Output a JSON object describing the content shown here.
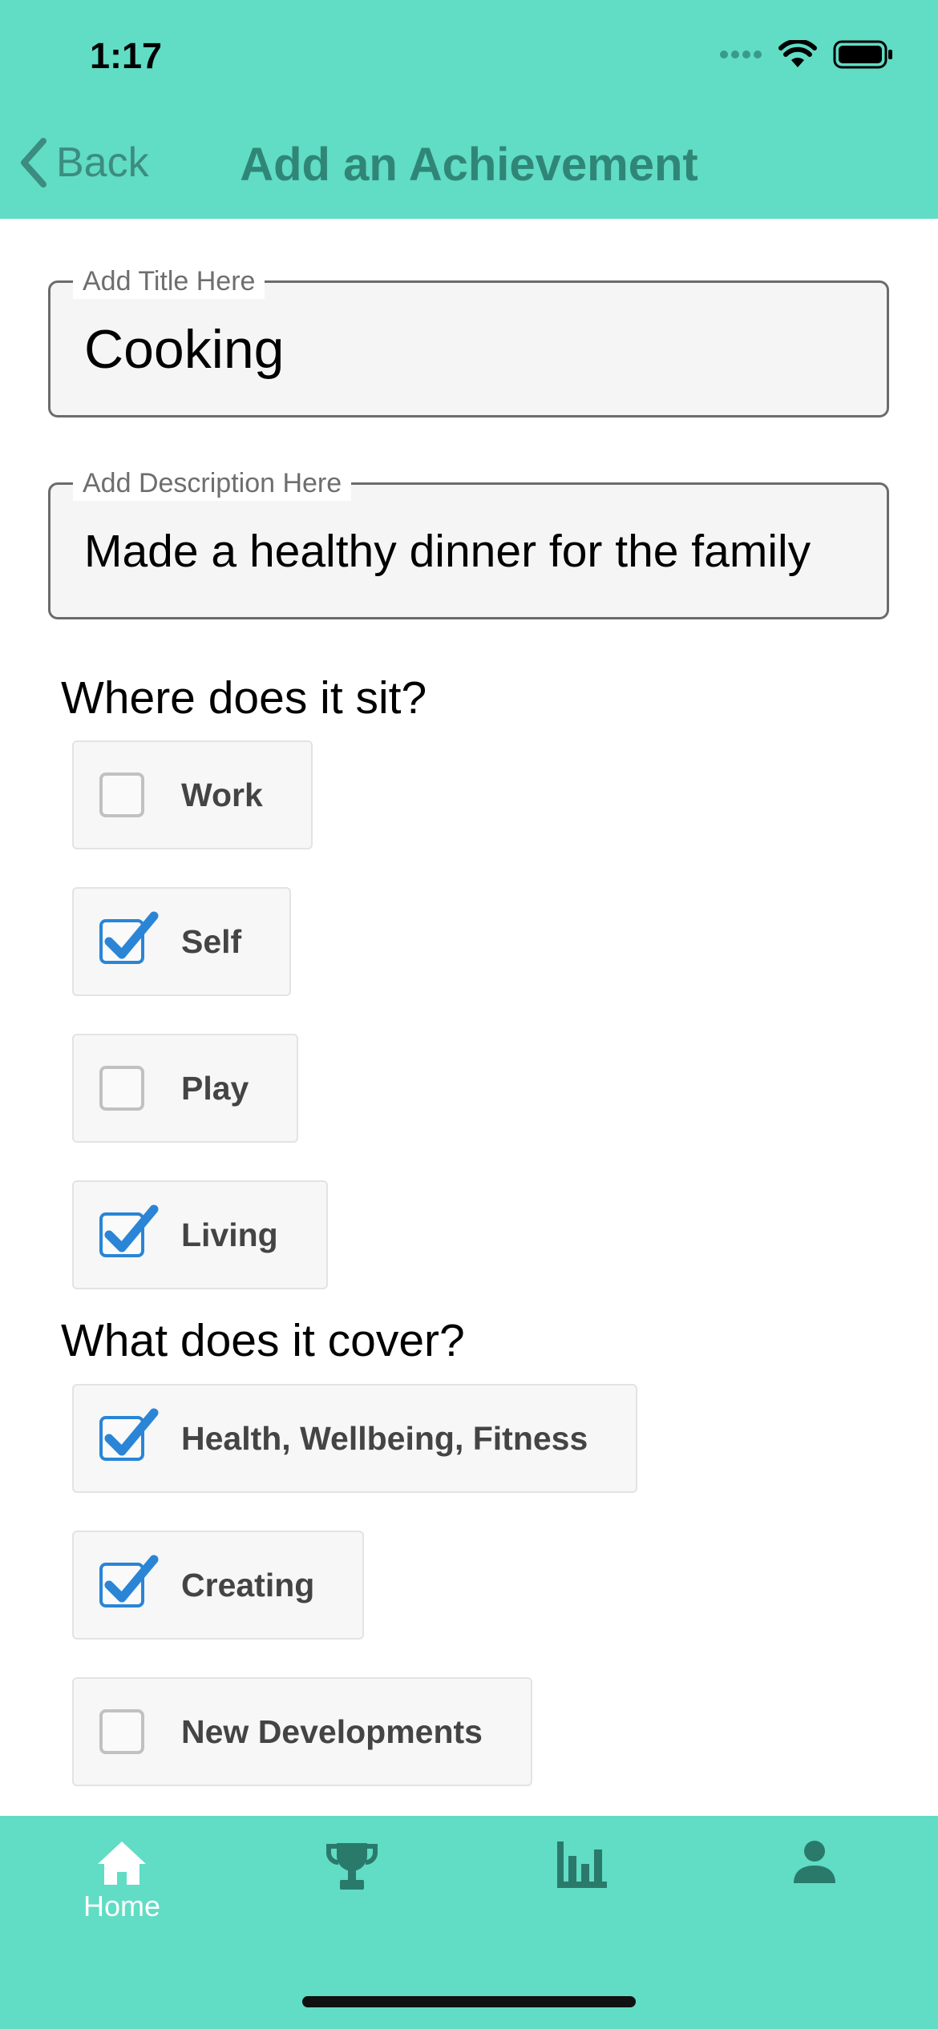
{
  "status_bar": {
    "time": "1:17"
  },
  "nav": {
    "back_label": "Back",
    "title": "Add an Achievement"
  },
  "form": {
    "title_field": {
      "label": "Add Title Here",
      "value": "Cooking"
    },
    "description_field": {
      "label": "Add Description Here",
      "value": "Made a healthy dinner for the family"
    }
  },
  "where_section": {
    "heading": "Where does it sit?",
    "options": [
      {
        "label": "Work",
        "checked": false
      },
      {
        "label": "Self",
        "checked": true
      },
      {
        "label": "Play",
        "checked": false
      },
      {
        "label": "Living",
        "checked": true
      }
    ]
  },
  "cover_section": {
    "heading": "What does it cover?",
    "options": [
      {
        "label": "Health, Wellbeing, Fitness",
        "checked": true
      },
      {
        "label": "Creating",
        "checked": true
      },
      {
        "label": "New Developments",
        "checked": false
      }
    ]
  },
  "tabbar": {
    "tabs": [
      {
        "icon": "home-icon",
        "label": "Home",
        "active": true
      },
      {
        "icon": "trophy-icon",
        "active": false
      },
      {
        "icon": "bar-chart-icon",
        "active": false
      },
      {
        "icon": "person-icon",
        "active": false
      }
    ]
  },
  "colors": {
    "accent": "#61dcc5",
    "header_text": "#2f8677",
    "checkbox": "#2a85d6",
    "icon_dark": "#2a7a6c"
  }
}
